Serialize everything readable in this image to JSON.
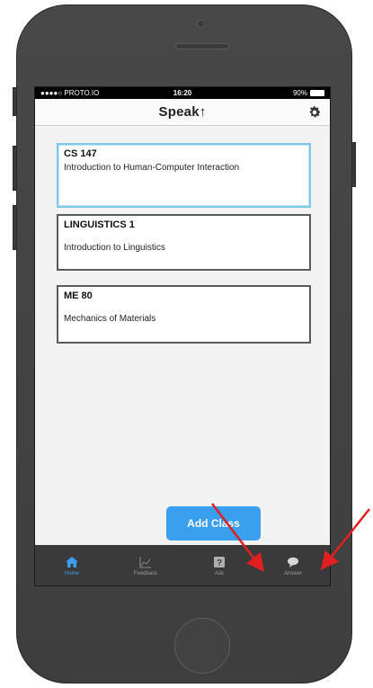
{
  "status_bar": {
    "carrier": "●●●●○ PROTO.IO",
    "time": "16:20",
    "battery": "90%"
  },
  "nav": {
    "title": "Speak↑",
    "settings_icon": "gear-icon"
  },
  "classes": [
    {
      "code": "CS 147",
      "name": "Introduction to Human-Computer Interaction",
      "selected": true
    },
    {
      "code": "LINGUISTICS 1",
      "name": "Introduction to Linguistics",
      "selected": false
    },
    {
      "code": "ME 80",
      "name": "Mechanics of Materials",
      "selected": false
    }
  ],
  "add_button": {
    "label": "Add Class"
  },
  "tabs": [
    {
      "label": "Home",
      "icon": "home-icon",
      "active": true
    },
    {
      "label": "Feedback",
      "icon": "chart-icon",
      "active": false
    },
    {
      "label": "Ask",
      "icon": "question-icon",
      "active": false
    },
    {
      "label": "Answer",
      "icon": "speech-bubble-icon",
      "active": false
    }
  ],
  "colors": {
    "accent": "#3b9ff0",
    "selected_border": "#7fc7e6",
    "tabbar": "#3a3a3a",
    "annotation_arrow": "#e02020"
  }
}
